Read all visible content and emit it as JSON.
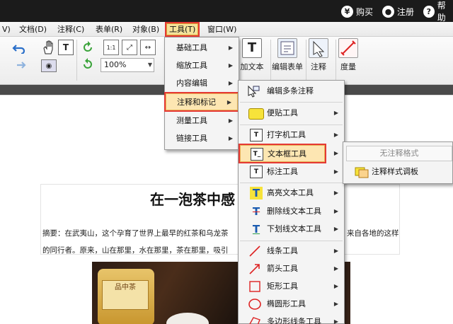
{
  "topbar": {
    "buy": "购买",
    "register": "注册",
    "help": "帮助"
  },
  "menubar": [
    "V)",
    "文档(D)",
    "注释(C)",
    "表单(R)",
    "对象(B)",
    "工具(T)",
    "窗口(W)"
  ],
  "toolbar": {
    "zoom_value": "100%",
    "add_text": "加文本",
    "edit_form": "编辑表单",
    "annotate": "注释",
    "measure": "度量"
  },
  "tools_menu": [
    "基础工具",
    "缩放工具",
    "内容编辑",
    "注释和标记",
    "测量工具",
    "链接工具"
  ],
  "annot_menu": [
    "编辑多条注释",
    "便贴工具",
    "打字机工具",
    "文本框工具",
    "标注工具",
    "高亮文本工具",
    "删除线文本工具",
    "下划线文本工具",
    "线条工具",
    "箭头工具",
    "矩形工具",
    "椭圆形工具",
    "多边形线条工具"
  ],
  "textbox_menu": {
    "style_placeholder": "无注释格式",
    "style_palette": "注释样式调板"
  },
  "document": {
    "title": "在一泡茶中感",
    "line1_left": "摘要：在武夷山，这个孕育了世界上最早的红茶和乌龙茶",
    "line1_right": "来自各地的这样",
    "line2": "的同行者。原来，山在那里，水在那里，茶在那里，吸引",
    "can_text": "品中茶"
  },
  "colors": {
    "highlight_border": "#e53935",
    "menu_hover": "#fde6b2"
  }
}
